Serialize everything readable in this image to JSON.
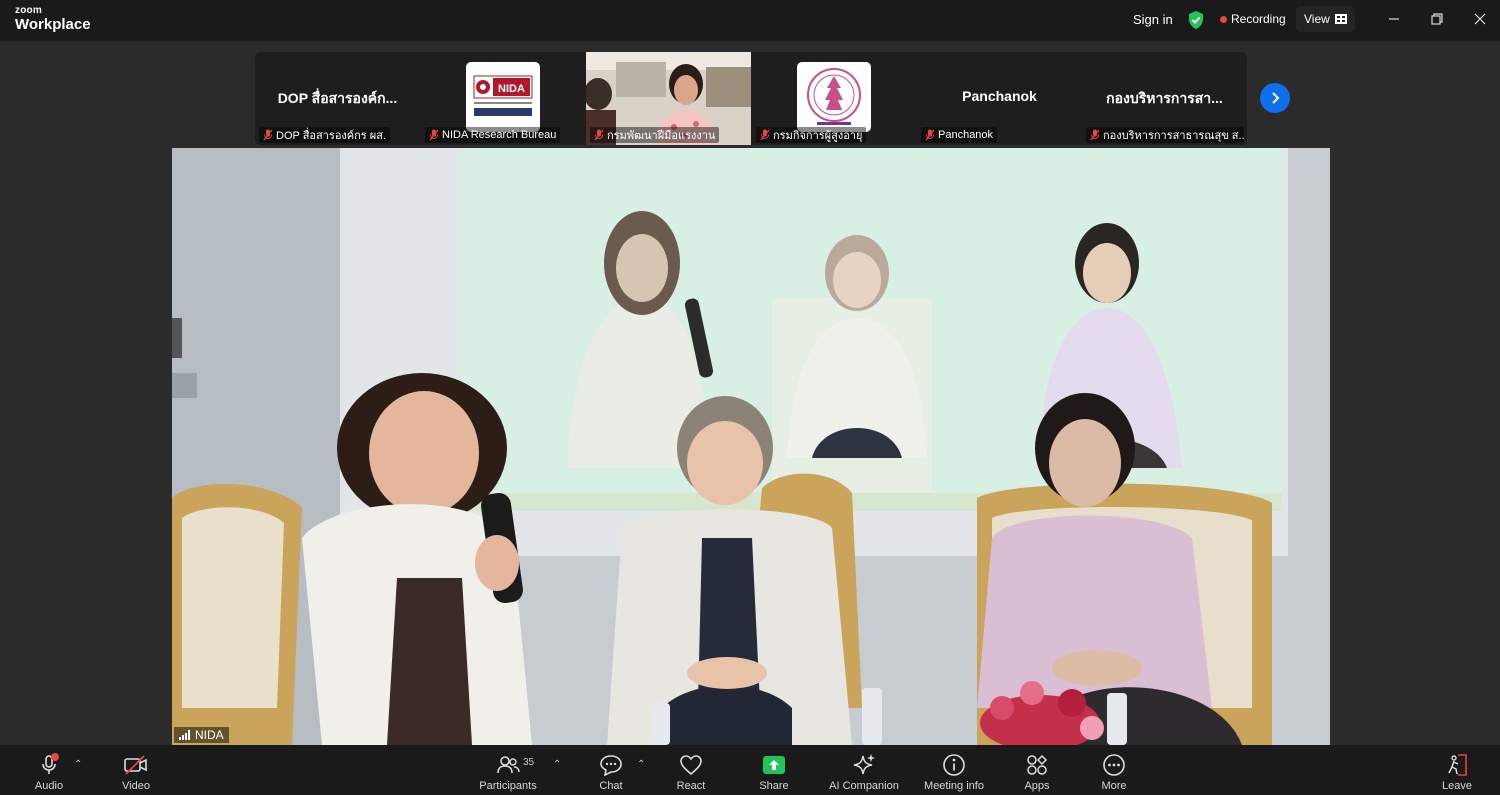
{
  "app": {
    "brand_small": "zoom",
    "brand_big": "Workplace"
  },
  "titlebar": {
    "sign_in": "Sign in",
    "recording": "Recording",
    "view": "View"
  },
  "participants_strip": [
    {
      "big_name": "DOP สื่อสารองค์ก...",
      "label": "DOP สื่อสารองค์กร ผส."
    },
    {
      "big_name": "",
      "label": "NIDA Research Bureau",
      "logo": "NIDA"
    },
    {
      "big_name": "",
      "label": "กรมพัฒนาฝีมือแรงงาน"
    },
    {
      "big_name": "",
      "label": "กรมกิจการผู้สูงอายุ"
    },
    {
      "big_name": "Panchanok",
      "label": "Panchanok"
    },
    {
      "big_name": "กองบริหารการสา...",
      "label": "กองบริหารการสาธารณสุข ส..."
    }
  ],
  "main_video": {
    "name": "NIDA"
  },
  "toolbar": {
    "audio": "Audio",
    "video": "Video",
    "participants": "Participants",
    "participants_count": "35",
    "chat": "Chat",
    "react": "React",
    "share": "Share",
    "ai_companion": "AI Companion",
    "meeting_info": "Meeting info",
    "apps": "Apps",
    "more": "More",
    "leave": "Leave"
  },
  "colors": {
    "accent": "#0e71eb",
    "share": "#21c35a",
    "recording": "#e84545",
    "mic_off": "#e84545",
    "shield": "#21c35a"
  }
}
